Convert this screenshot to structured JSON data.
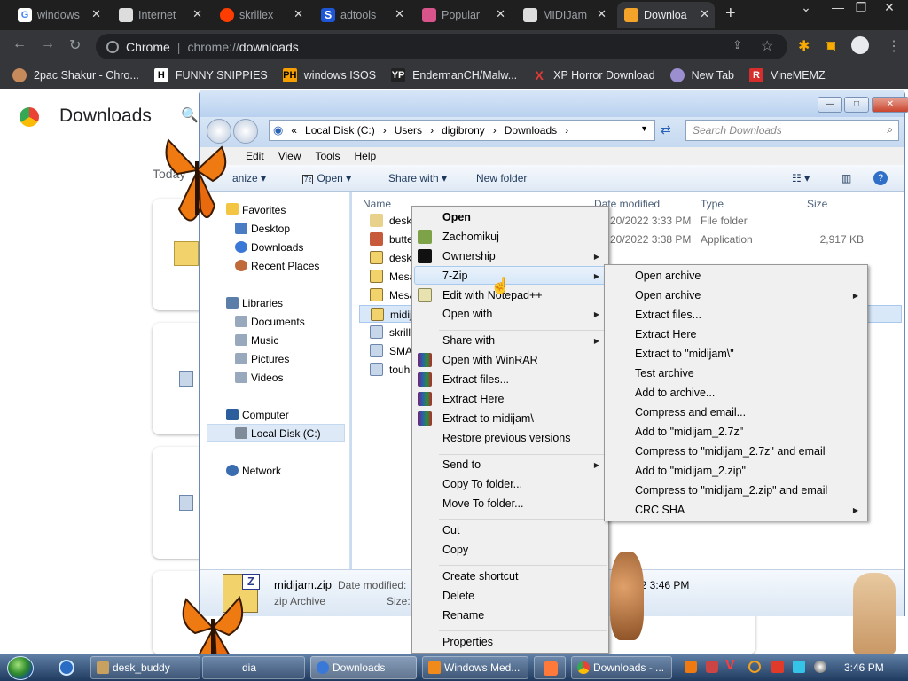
{
  "browser": {
    "tabs": [
      {
        "title": "windows",
        "color": "#4285f4"
      },
      {
        "title": "Internet",
        "color": "#888888"
      },
      {
        "title": "skrillex",
        "color": "#ff3d00"
      },
      {
        "title": "adtools",
        "color": "#1e56d8"
      },
      {
        "title": "Popular",
        "color": "#d8548a"
      },
      {
        "title": "MIDIJam",
        "color": "#888888"
      },
      {
        "title": "Downloa",
        "color": "#f3a22a"
      }
    ],
    "address": {
      "host": "Chrome",
      "path_prefix": "chrome://",
      "path": "downloads"
    },
    "bookmarks": [
      {
        "label": "2pac Shakur - Chro...",
        "icon": "tupac-icon"
      },
      {
        "label": "FUNNY SNIPPIES",
        "icon": "H"
      },
      {
        "label": "windows ISOS",
        "icon": "PH"
      },
      {
        "label": "EndermanCH/Malw...",
        "icon": "YP"
      },
      {
        "label": "XP Horror Download",
        "icon": "X"
      },
      {
        "label": "New Tab",
        "icon": "globe-icon"
      },
      {
        "label": "VineMEMZ",
        "icon": "R"
      }
    ]
  },
  "downloads_page": {
    "title": "Downloads",
    "section": "Today"
  },
  "explorer": {
    "breadcrumb": [
      "Local Disk (C:)",
      "Users",
      "digibrony",
      "Downloads"
    ],
    "search_placeholder": "Search Downloads",
    "menu": [
      "Edit",
      "View",
      "Tools",
      "Help"
    ],
    "commands": {
      "organize": "anize",
      "open": "Open",
      "share": "Share with",
      "new_folder": "New folder"
    },
    "nav": {
      "favorites": "Favorites",
      "desktop": "Desktop",
      "downloads": "Downloads",
      "recent": "Recent Places",
      "libraries": "Libraries",
      "documents": "Documents",
      "music": "Music",
      "pictures": "Pictures",
      "videos": "Videos",
      "computer": "Computer",
      "localdisk": "Local Disk (C:)",
      "network": "Network"
    },
    "columns": {
      "name": "Name",
      "date": "Date modified",
      "type": "Type",
      "size": "Size"
    },
    "files": [
      {
        "name": "desk_b",
        "date": "20/2022 3:33 PM",
        "type": "File folder",
        "size": ""
      },
      {
        "name": "butterf",
        "date": "20/2022 3:38 PM",
        "type": "Application",
        "size": "2,917 KB"
      },
      {
        "name": "desk_b",
        "date": "",
        "type": "",
        "size": ""
      },
      {
        "name": "MesaF",
        "date": "",
        "type": "",
        "size": ""
      },
      {
        "name": "MesaF",
        "date": "",
        "type": "",
        "size": ""
      },
      {
        "name": "midija",
        "date": "",
        "type": "",
        "size": ""
      },
      {
        "name": "skrillex",
        "date": "",
        "type": "",
        "size": ""
      },
      {
        "name": "SMASH",
        "date": "",
        "type": "",
        "size": ""
      },
      {
        "name": "touho",
        "date": "",
        "type": "",
        "size": ""
      }
    ],
    "details": {
      "name": "midijam.zip",
      "type": "zip Archive",
      "date_label": "Date modified:",
      "size_label": "Size:",
      "date_value": "22 3:46 PM"
    }
  },
  "context_menu": [
    "Open",
    "Zachomikuj",
    "Ownership",
    "7-Zip",
    "Edit with Notepad++",
    "Open with",
    "Share with",
    "Open with WinRAR",
    "Extract files...",
    "Extract Here",
    "Extract to midijam\\",
    "Restore previous versions",
    "Send to",
    "Copy To folder...",
    "Move To folder...",
    "Cut",
    "Copy",
    "Create shortcut",
    "Delete",
    "Rename",
    "Properties"
  ],
  "submenu_7zip": [
    "Open archive",
    "Open archive",
    "Extract files...",
    "Extract Here",
    "Extract to \"midijam\\\"",
    "Test archive",
    "Add to archive...",
    "Compress and email...",
    "Add to \"midijam_2.7z\"",
    "Compress to \"midijam_2.7z\" and email",
    "Add to \"midijam_2.zip\"",
    "Compress to \"midijam_2.zip\" and email",
    "CRC SHA"
  ],
  "taskbar": {
    "items": [
      "desk_buddy",
      "dia",
      "Downloads",
      "Windows Med...",
      "",
      "Downloads - ..."
    ],
    "clock": "3:46 PM"
  },
  "colors": {
    "chrome_dark": "#35363a",
    "highlight": "#d7e7f8",
    "accent": "#1a73e8"
  }
}
